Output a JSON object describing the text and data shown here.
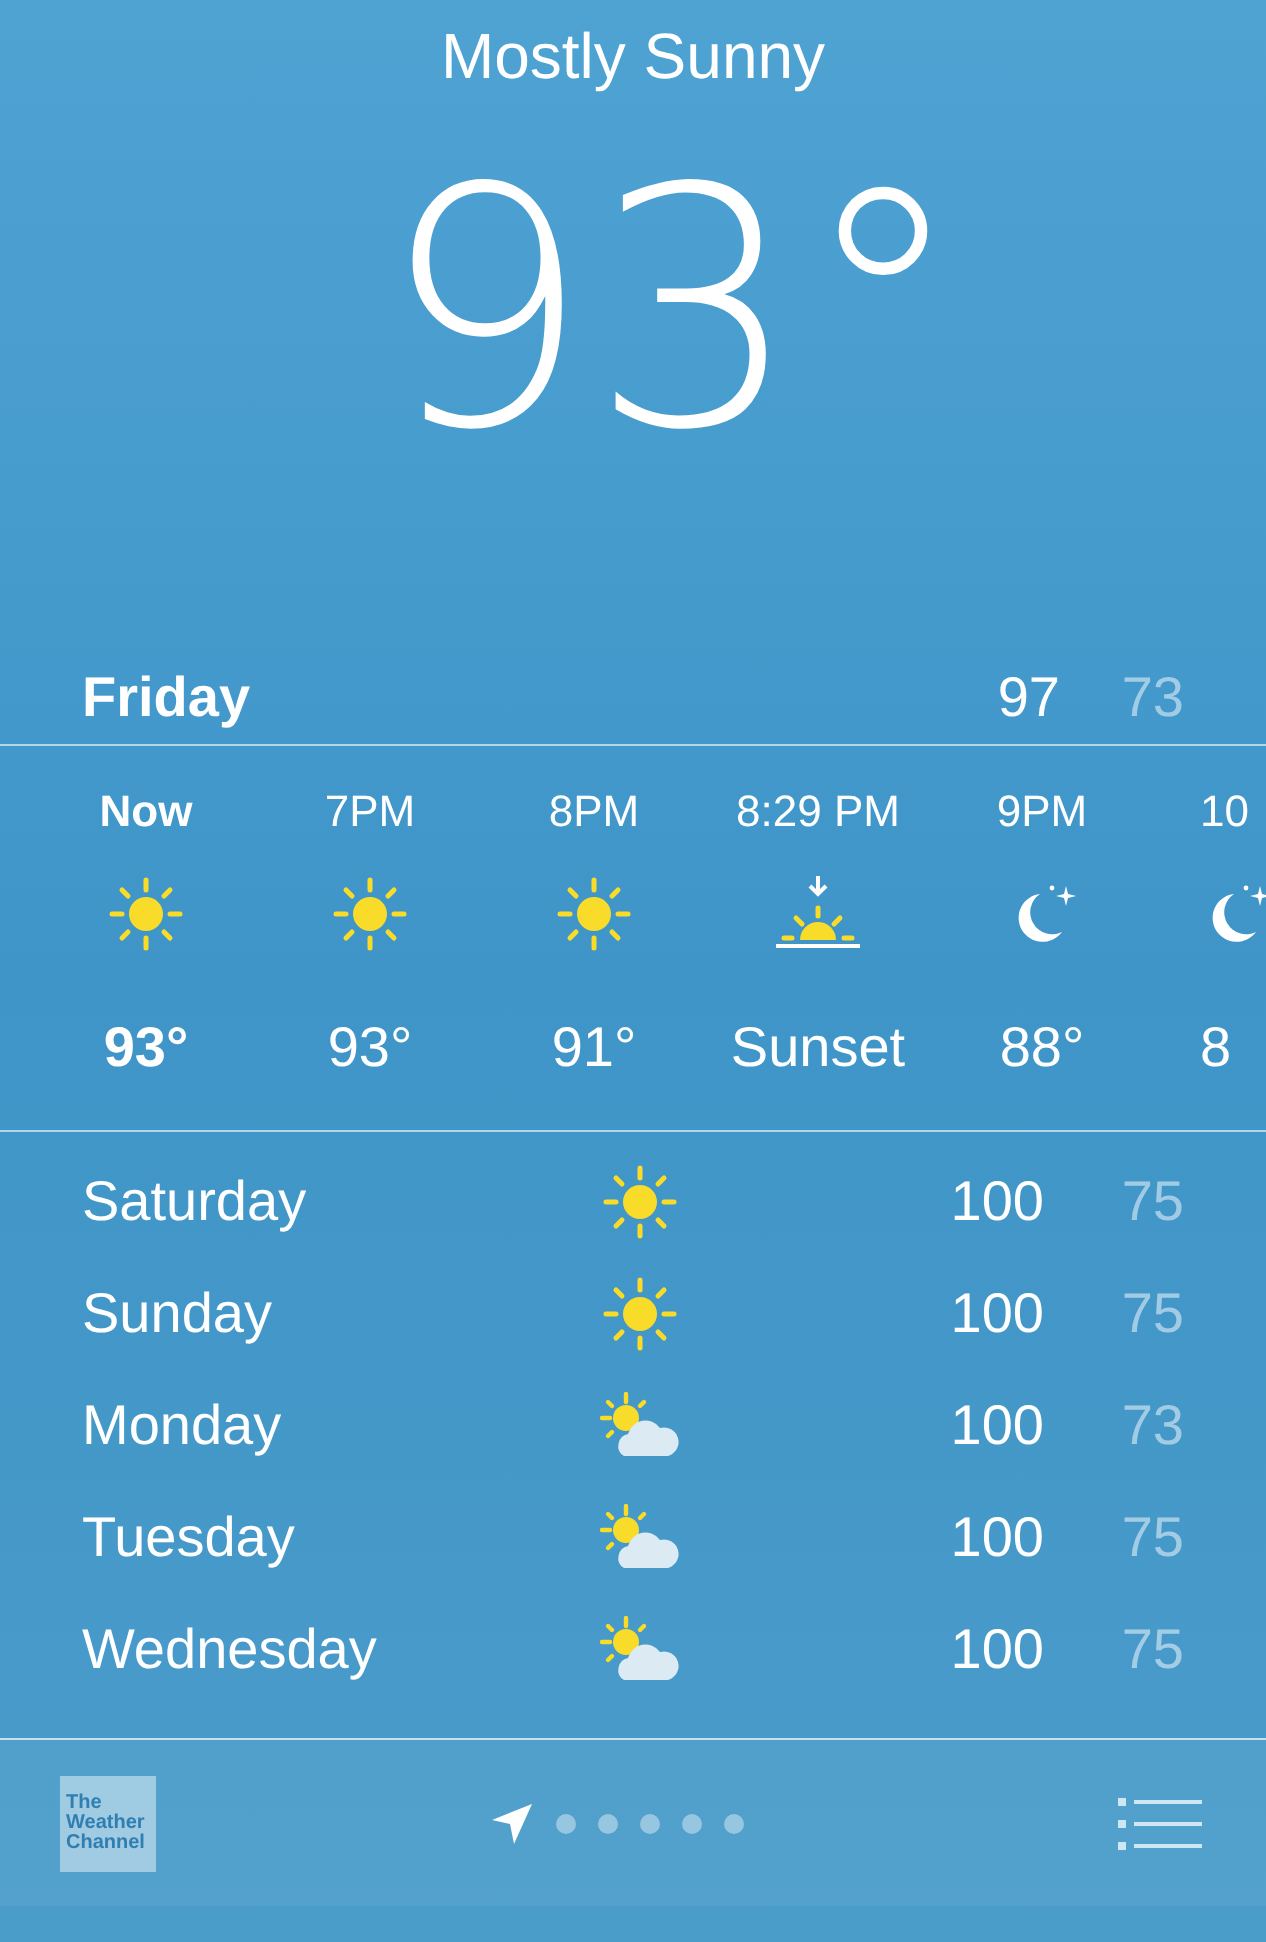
{
  "condition": "Mostly Sunny",
  "temperature": "93°",
  "today": {
    "day": "Friday",
    "high": "97",
    "low": "73"
  },
  "hourly": [
    {
      "time": "Now",
      "kind": "sun",
      "value": "93°",
      "current": true
    },
    {
      "time": "7PM",
      "kind": "sun",
      "value": "93°",
      "current": false
    },
    {
      "time": "8PM",
      "kind": "sun",
      "value": "91°",
      "current": false
    },
    {
      "time": "8:29 PM",
      "kind": "sunset",
      "value": "Sunset",
      "current": false
    },
    {
      "time": "9PM",
      "kind": "moon",
      "value": "88°",
      "current": false
    },
    {
      "time": "10",
      "kind": "moon",
      "value": "8",
      "current": false
    }
  ],
  "daily": [
    {
      "day": "Saturday",
      "kind": "sun",
      "high": "100",
      "low": "75"
    },
    {
      "day": "Sunday",
      "kind": "sun",
      "high": "100",
      "low": "75"
    },
    {
      "day": "Monday",
      "kind": "partly_cloudy",
      "high": "100",
      "low": "73"
    },
    {
      "day": "Tuesday",
      "kind": "partly_cloudy",
      "high": "100",
      "low": "75"
    },
    {
      "day": "Wednesday",
      "kind": "partly_cloudy",
      "high": "100",
      "low": "75"
    }
  ],
  "footer": {
    "logo": [
      "The",
      "Weather",
      "Channel"
    ],
    "pages": [
      {
        "kind": "location",
        "selected": true
      },
      {
        "kind": "dot",
        "selected": false
      },
      {
        "kind": "dot",
        "selected": false
      },
      {
        "kind": "dot",
        "selected": false
      },
      {
        "kind": "dot",
        "selected": false
      },
      {
        "kind": "dot",
        "selected": false
      }
    ]
  }
}
